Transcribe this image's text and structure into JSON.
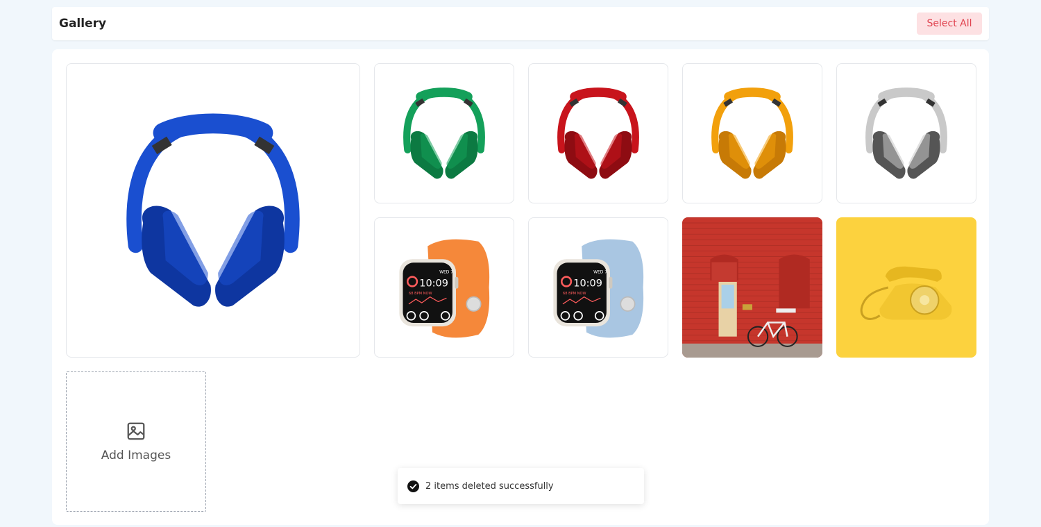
{
  "header": {
    "title": "Gallery",
    "select_all_label": "Select All"
  },
  "gallery": {
    "items": [
      {
        "name": "headphones-blue-image",
        "kind": "headphones",
        "color": "#1a4fd0",
        "dark": "#0e36a0"
      },
      {
        "name": "headphones-green-image",
        "kind": "headphones",
        "color": "#14a05a",
        "dark": "#0c7a42"
      },
      {
        "name": "headphones-red-image",
        "kind": "headphones",
        "color": "#c8141c",
        "dark": "#8e0c12"
      },
      {
        "name": "headphones-orange-image",
        "kind": "headphones",
        "color": "#f2a00c",
        "dark": "#c77a06"
      },
      {
        "name": "headphones-silver-image",
        "kind": "headphones",
        "color": "#c9c9c9",
        "dark": "#555555"
      },
      {
        "name": "watch-orange-band-image",
        "kind": "watch",
        "color": "#f5883a",
        "dark": "#e07020"
      },
      {
        "name": "watch-blue-band-image",
        "kind": "watch",
        "color": "#a9c6e2",
        "dark": "#8aaed0"
      },
      {
        "name": "red-wall-bicycle-image",
        "kind": "wall",
        "color": "#c6362c",
        "dark": "#9c2a22"
      },
      {
        "name": "yellow-telephone-image",
        "kind": "phone",
        "color": "#fcd23e",
        "dark": "#e8b820"
      }
    ],
    "add_label": "Add Images"
  },
  "toast": {
    "message": "2 items deleted successfully"
  }
}
